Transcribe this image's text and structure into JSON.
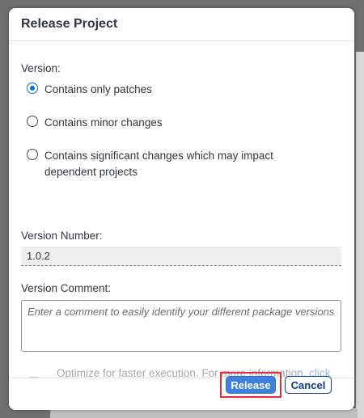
{
  "dialog": {
    "title": "Release Project",
    "version_label": "Version:",
    "options": [
      {
        "label": "Contains only patches",
        "checked": true
      },
      {
        "label": "Contains minor changes",
        "checked": false
      },
      {
        "label": "Contains significant changes which may impact dependent projects",
        "checked": false
      }
    ],
    "version_number_label": "Version Number:",
    "version_number_value": "1.0.2",
    "version_comment_label": "Version Comment:",
    "version_comment_placeholder": "Enter a comment to easily identify your different package versions",
    "optimize": {
      "checked": false,
      "text": "Optimize for faster execution. For more information, ",
      "link_text": "click here",
      "suffix": "."
    },
    "buttons": {
      "release": "Release",
      "cancel": "Cancel"
    }
  },
  "colors": {
    "accent": "#0a6ed1",
    "release_button": "#3e7fe0",
    "highlight": "#e0303a"
  }
}
